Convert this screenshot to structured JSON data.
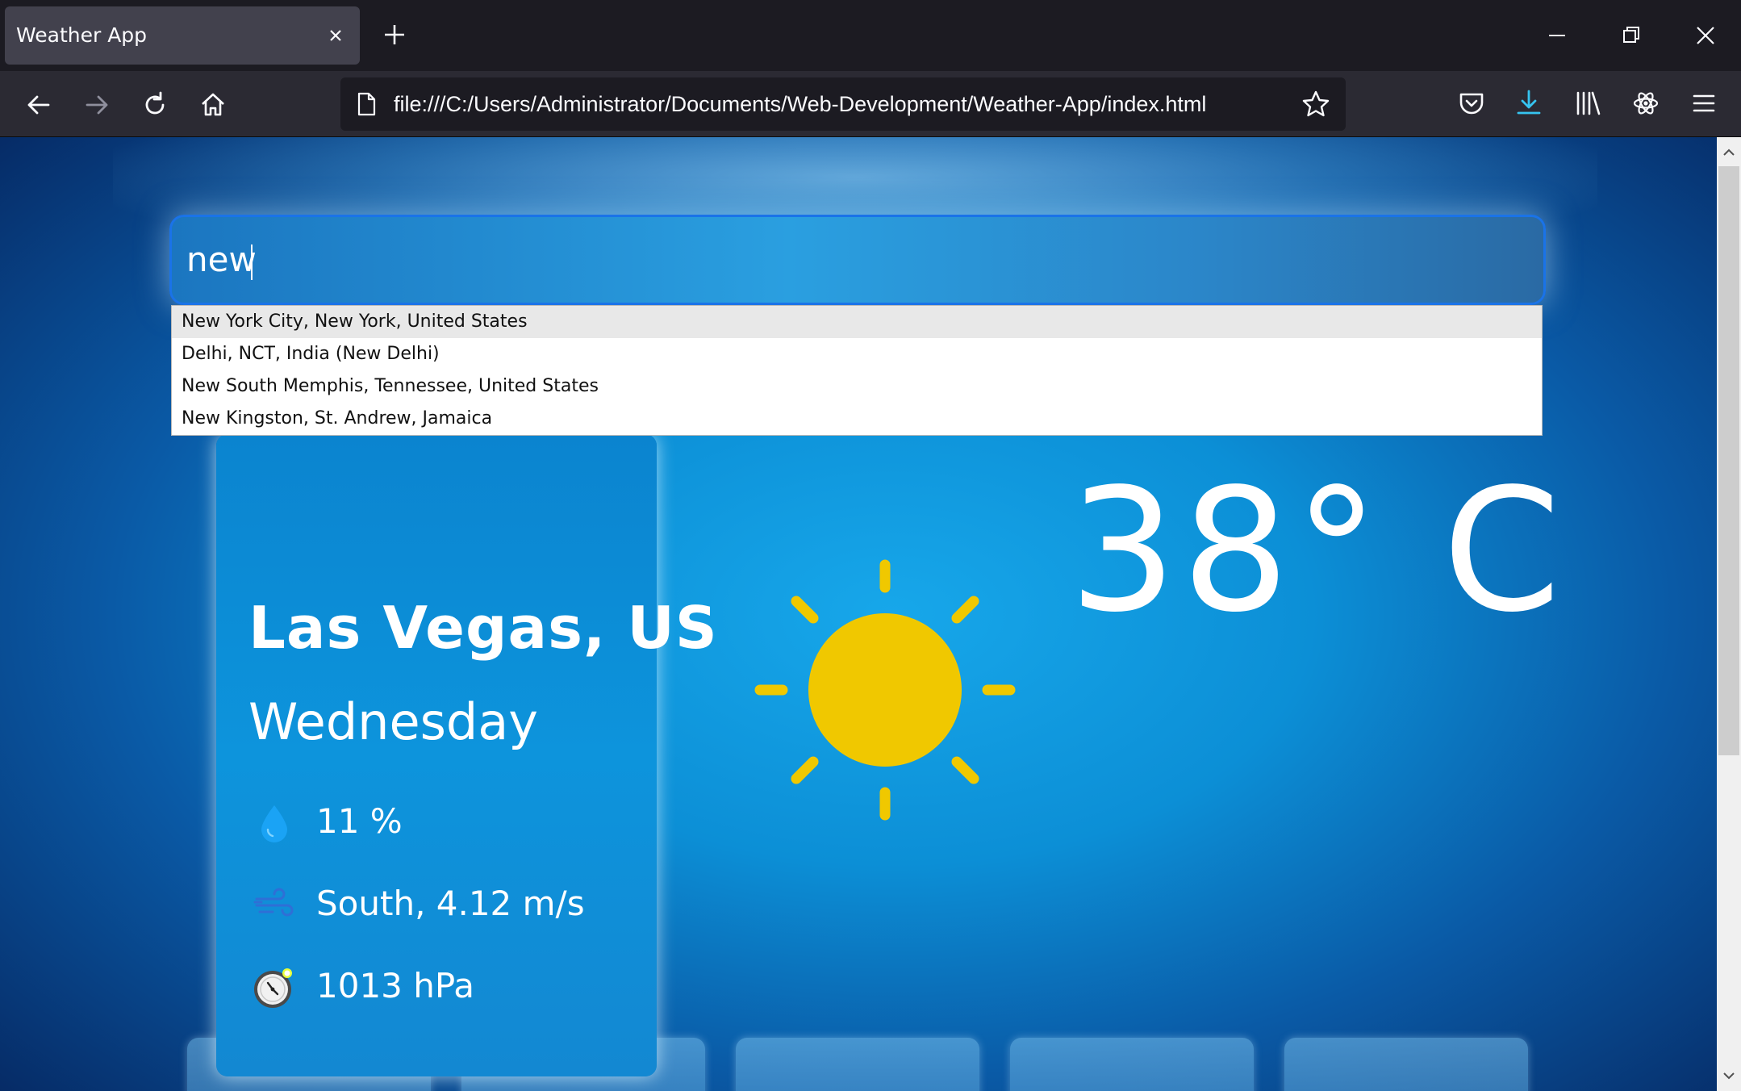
{
  "browser": {
    "tab_title": "Weather App",
    "url": "file:///C:/Users/Administrator/Documents/Web-Development/Weather-App/index.html"
  },
  "search": {
    "value": "new",
    "suggestions": [
      "New York City, New York, United States",
      "Delhi, NCT, India (New Delhi)",
      "New South Memphis, Tennessee, United States",
      "New Kingston, St. Andrew, Jamaica"
    ]
  },
  "weather": {
    "city": "Las Vegas, US",
    "day": "Wednesday",
    "humidity": "11 %",
    "wind": "South, 4.12 m/s",
    "pressure": "1013 hPa",
    "temperature": "38° C",
    "condition_icon": "sun-icon"
  },
  "colors": {
    "accent": "#1a73e8",
    "sun": "#f0c800",
    "drop": "#1aa3f5",
    "background": "#0c8fd6"
  }
}
